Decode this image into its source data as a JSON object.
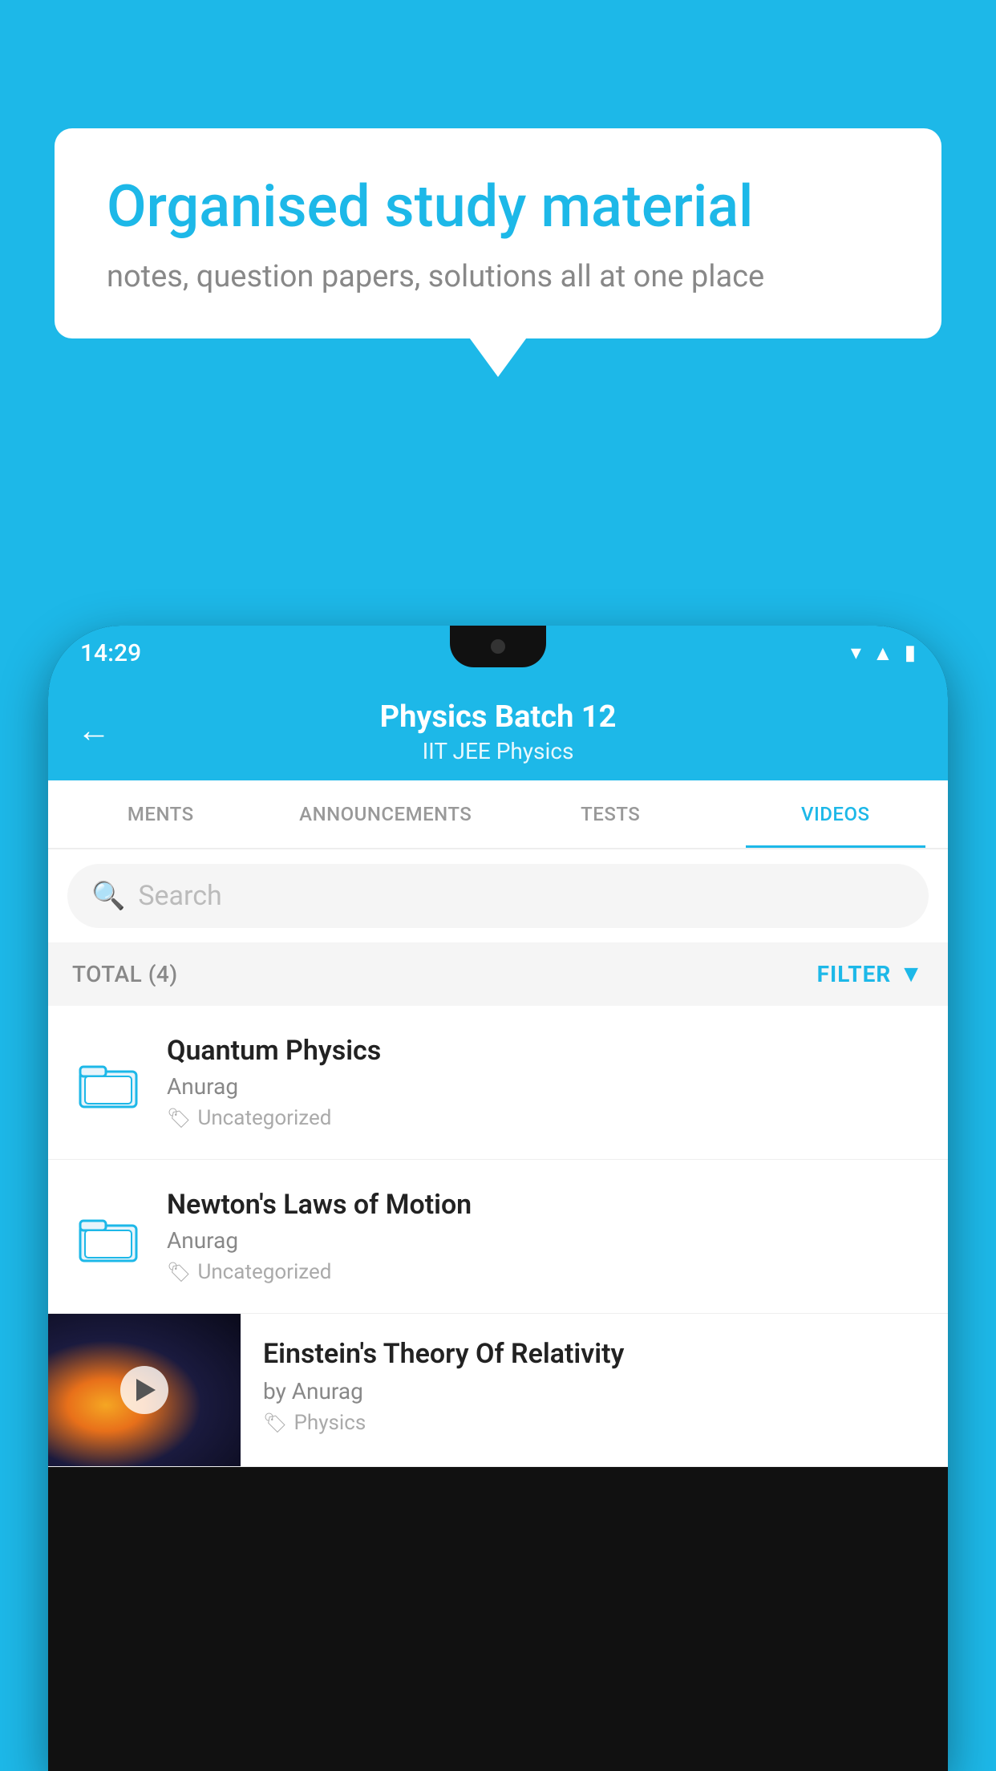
{
  "background_color": "#1DB8E8",
  "bubble": {
    "title": "Organised study material",
    "subtitle": "notes, question papers, solutions all at one place"
  },
  "phone": {
    "status_bar": {
      "time": "14:29",
      "icons": [
        "wifi",
        "signal",
        "battery"
      ]
    },
    "header": {
      "back_label": "←",
      "title": "Physics Batch 12",
      "subtitle_tags": "IIT JEE   Physics"
    },
    "tabs": [
      {
        "label": "MENTS",
        "active": false
      },
      {
        "label": "ANNOUNCEMENTS",
        "active": false
      },
      {
        "label": "TESTS",
        "active": false
      },
      {
        "label": "VIDEOS",
        "active": true
      }
    ],
    "search": {
      "placeholder": "Search"
    },
    "filter_bar": {
      "total_label": "TOTAL (4)",
      "filter_label": "FILTER"
    },
    "videos": [
      {
        "title": "Quantum Physics",
        "author": "Anurag",
        "tag": "Uncategorized",
        "has_thumb": false
      },
      {
        "title": "Newton's Laws of Motion",
        "author": "Anurag",
        "tag": "Uncategorized",
        "has_thumb": false
      },
      {
        "title": "Einstein's Theory Of Relativity",
        "author": "by Anurag",
        "tag": "Physics",
        "has_thumb": true
      }
    ]
  }
}
